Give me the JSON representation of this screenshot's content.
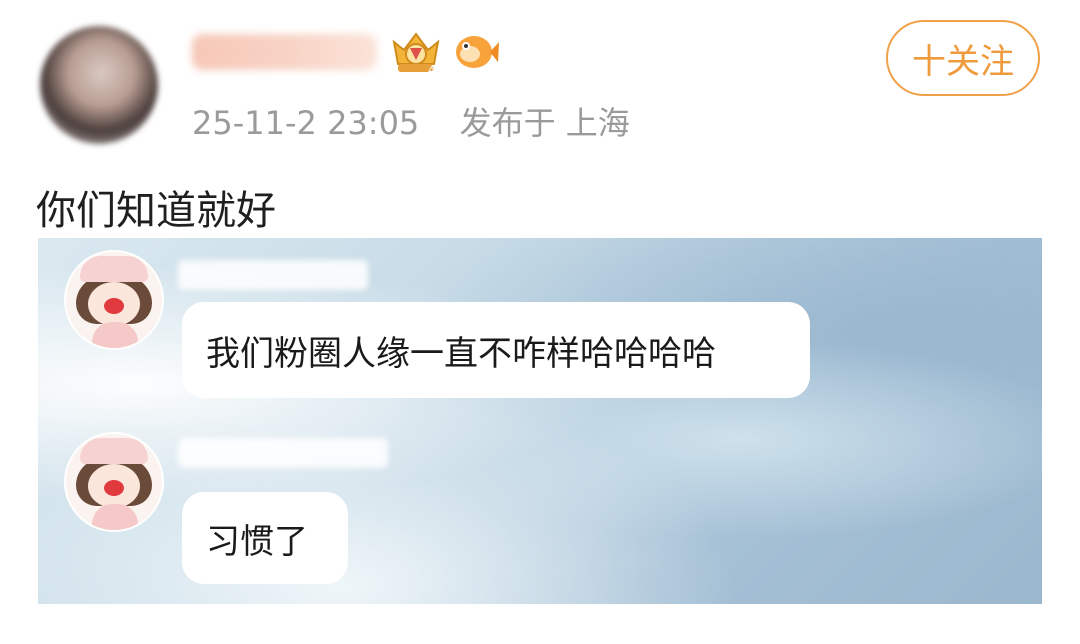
{
  "post": {
    "timestamp": "25-11-2 23:05",
    "location": "发布于 上海",
    "follow_label": "十关注",
    "text": "你们知道就好"
  },
  "image": {
    "messages": [
      {
        "text": "我们粉圈人缘一直不咋样哈哈哈哈"
      },
      {
        "text": "习惯了"
      }
    ]
  },
  "colors": {
    "accent": "#f0a14a",
    "timestamp": "#9a9a9a",
    "text": "#1f1f1f"
  },
  "icons": {
    "badges": [
      "crown-level-badge-icon",
      "fish-badge-icon"
    ]
  }
}
